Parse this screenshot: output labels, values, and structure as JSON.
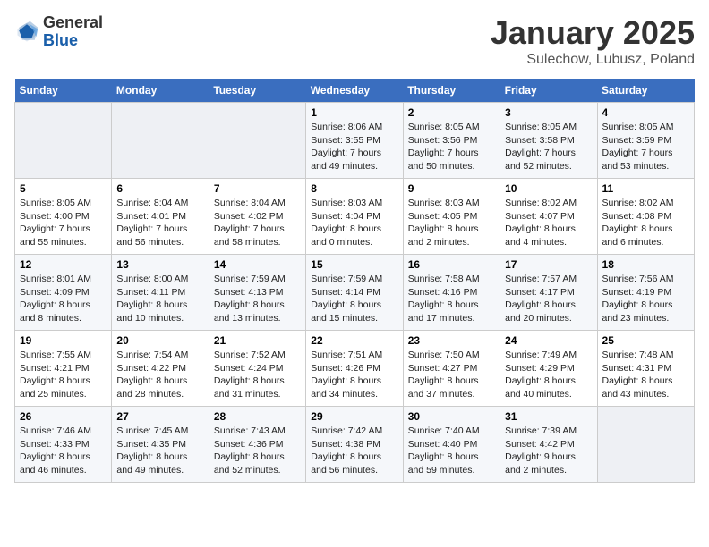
{
  "header": {
    "logo_general": "General",
    "logo_blue": "Blue",
    "month_title": "January 2025",
    "subtitle": "Sulechow, Lubusz, Poland"
  },
  "days_of_week": [
    "Sunday",
    "Monday",
    "Tuesday",
    "Wednesday",
    "Thursday",
    "Friday",
    "Saturday"
  ],
  "weeks": [
    {
      "cells": [
        {
          "day": null,
          "data": null
        },
        {
          "day": null,
          "data": null
        },
        {
          "day": null,
          "data": null
        },
        {
          "day": "1",
          "data": "Sunrise: 8:06 AM\nSunset: 3:55 PM\nDaylight: 7 hours and 49 minutes."
        },
        {
          "day": "2",
          "data": "Sunrise: 8:05 AM\nSunset: 3:56 PM\nDaylight: 7 hours and 50 minutes."
        },
        {
          "day": "3",
          "data": "Sunrise: 8:05 AM\nSunset: 3:58 PM\nDaylight: 7 hours and 52 minutes."
        },
        {
          "day": "4",
          "data": "Sunrise: 8:05 AM\nSunset: 3:59 PM\nDaylight: 7 hours and 53 minutes."
        }
      ]
    },
    {
      "cells": [
        {
          "day": "5",
          "data": "Sunrise: 8:05 AM\nSunset: 4:00 PM\nDaylight: 7 hours and 55 minutes."
        },
        {
          "day": "6",
          "data": "Sunrise: 8:04 AM\nSunset: 4:01 PM\nDaylight: 7 hours and 56 minutes."
        },
        {
          "day": "7",
          "data": "Sunrise: 8:04 AM\nSunset: 4:02 PM\nDaylight: 7 hours and 58 minutes."
        },
        {
          "day": "8",
          "data": "Sunrise: 8:03 AM\nSunset: 4:04 PM\nDaylight: 8 hours and 0 minutes."
        },
        {
          "day": "9",
          "data": "Sunrise: 8:03 AM\nSunset: 4:05 PM\nDaylight: 8 hours and 2 minutes."
        },
        {
          "day": "10",
          "data": "Sunrise: 8:02 AM\nSunset: 4:07 PM\nDaylight: 8 hours and 4 minutes."
        },
        {
          "day": "11",
          "data": "Sunrise: 8:02 AM\nSunset: 4:08 PM\nDaylight: 8 hours and 6 minutes."
        }
      ]
    },
    {
      "cells": [
        {
          "day": "12",
          "data": "Sunrise: 8:01 AM\nSunset: 4:09 PM\nDaylight: 8 hours and 8 minutes."
        },
        {
          "day": "13",
          "data": "Sunrise: 8:00 AM\nSunset: 4:11 PM\nDaylight: 8 hours and 10 minutes."
        },
        {
          "day": "14",
          "data": "Sunrise: 7:59 AM\nSunset: 4:13 PM\nDaylight: 8 hours and 13 minutes."
        },
        {
          "day": "15",
          "data": "Sunrise: 7:59 AM\nSunset: 4:14 PM\nDaylight: 8 hours and 15 minutes."
        },
        {
          "day": "16",
          "data": "Sunrise: 7:58 AM\nSunset: 4:16 PM\nDaylight: 8 hours and 17 minutes."
        },
        {
          "day": "17",
          "data": "Sunrise: 7:57 AM\nSunset: 4:17 PM\nDaylight: 8 hours and 20 minutes."
        },
        {
          "day": "18",
          "data": "Sunrise: 7:56 AM\nSunset: 4:19 PM\nDaylight: 8 hours and 23 minutes."
        }
      ]
    },
    {
      "cells": [
        {
          "day": "19",
          "data": "Sunrise: 7:55 AM\nSunset: 4:21 PM\nDaylight: 8 hours and 25 minutes."
        },
        {
          "day": "20",
          "data": "Sunrise: 7:54 AM\nSunset: 4:22 PM\nDaylight: 8 hours and 28 minutes."
        },
        {
          "day": "21",
          "data": "Sunrise: 7:52 AM\nSunset: 4:24 PM\nDaylight: 8 hours and 31 minutes."
        },
        {
          "day": "22",
          "data": "Sunrise: 7:51 AM\nSunset: 4:26 PM\nDaylight: 8 hours and 34 minutes."
        },
        {
          "day": "23",
          "data": "Sunrise: 7:50 AM\nSunset: 4:27 PM\nDaylight: 8 hours and 37 minutes."
        },
        {
          "day": "24",
          "data": "Sunrise: 7:49 AM\nSunset: 4:29 PM\nDaylight: 8 hours and 40 minutes."
        },
        {
          "day": "25",
          "data": "Sunrise: 7:48 AM\nSunset: 4:31 PM\nDaylight: 8 hours and 43 minutes."
        }
      ]
    },
    {
      "cells": [
        {
          "day": "26",
          "data": "Sunrise: 7:46 AM\nSunset: 4:33 PM\nDaylight: 8 hours and 46 minutes."
        },
        {
          "day": "27",
          "data": "Sunrise: 7:45 AM\nSunset: 4:35 PM\nDaylight: 8 hours and 49 minutes."
        },
        {
          "day": "28",
          "data": "Sunrise: 7:43 AM\nSunset: 4:36 PM\nDaylight: 8 hours and 52 minutes."
        },
        {
          "day": "29",
          "data": "Sunrise: 7:42 AM\nSunset: 4:38 PM\nDaylight: 8 hours and 56 minutes."
        },
        {
          "day": "30",
          "data": "Sunrise: 7:40 AM\nSunset: 4:40 PM\nDaylight: 8 hours and 59 minutes."
        },
        {
          "day": "31",
          "data": "Sunrise: 7:39 AM\nSunset: 4:42 PM\nDaylight: 9 hours and 2 minutes."
        },
        {
          "day": null,
          "data": null
        }
      ]
    }
  ]
}
